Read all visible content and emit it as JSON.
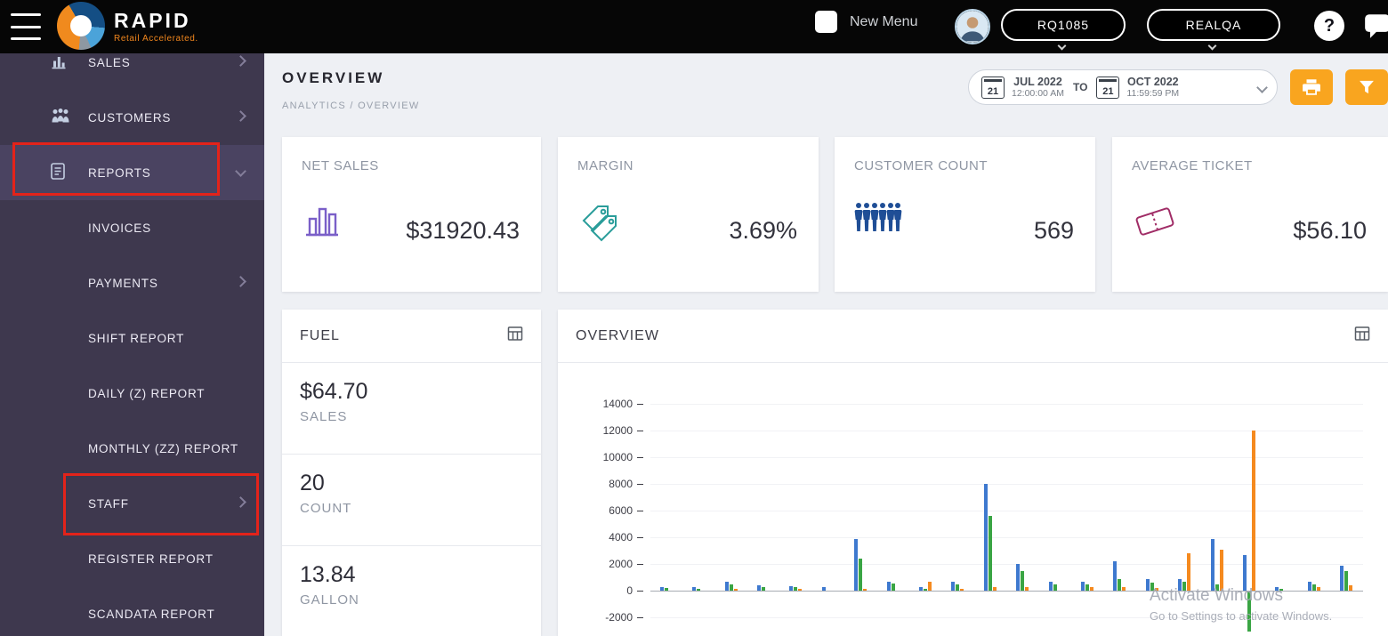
{
  "header": {
    "brand_name": "RAPID",
    "brand_tagline": "Retail Accelerated.",
    "new_menu_label": "New Menu",
    "store_code": "RQ1085",
    "env_code": "REALQA",
    "help_glyph": "?"
  },
  "sidebar": {
    "items": [
      {
        "label": "SALES",
        "icon": "sales-bars-icon"
      },
      {
        "label": "CUSTOMERS",
        "icon": "customers-people-icon"
      },
      {
        "label": "REPORTS",
        "icon": "report-document-icon"
      }
    ],
    "report_items": [
      "INVOICES",
      "PAYMENTS",
      "SHIFT REPORT",
      "DAILY (Z) REPORT",
      "MONTHLY (ZZ) REPORT",
      "STAFF",
      "REGISTER REPORT",
      "SCANDATA REPORT"
    ]
  },
  "page": {
    "title": "OVERVIEW",
    "breadcrumb": "ANALYTICS / OVERVIEW"
  },
  "date_range": {
    "start_day": "21",
    "start_month": "JUL 2022",
    "start_time": "12:00:00 AM",
    "to_label": "TO",
    "end_day": "21",
    "end_month": "OCT 2022",
    "end_time": "11:59:59 PM"
  },
  "toolbar": {
    "print_icon": "printer-icon",
    "filter_icon": "funnel-icon"
  },
  "kpis": [
    {
      "label": "NET SALES",
      "value": "$31920.43",
      "icon": "bar-chart-icon",
      "color": "#7a5fc8"
    },
    {
      "label": "MARGIN",
      "value": "3.69%",
      "icon": "price-tags-icon",
      "color": "#2a9d9a"
    },
    {
      "label": "CUSTOMER COUNT",
      "value": "569",
      "icon": "people-group-icon",
      "color": "#1f4e96"
    },
    {
      "label": "AVERAGE TICKET",
      "value": "$56.10",
      "icon": "ticket-icon",
      "color": "#a02c66"
    }
  ],
  "fuel": {
    "title": "FUEL",
    "table_icon": "table-icon",
    "stats": [
      {
        "value": "$64.70",
        "label": "SALES"
      },
      {
        "value": "20",
        "label": "COUNT"
      },
      {
        "value": "13.84",
        "label": "GALLON"
      }
    ]
  },
  "overview_panel": {
    "title": "OVERVIEW",
    "table_icon": "table-icon"
  },
  "watermark": {
    "line1": "Activate Windows",
    "line2": "Go to Settings to activate Windows."
  },
  "chart_data": {
    "type": "bar",
    "title": "OVERVIEW",
    "ylim": [
      -2000,
      14000
    ],
    "yticks": [
      14000,
      12000,
      10000,
      8000,
      6000,
      4000,
      2000,
      0,
      -2000
    ],
    "grid": false,
    "legend": "none",
    "x_count": 22,
    "series": [
      {
        "name": "blue",
        "color": "#3e79cf",
        "values": [
          300,
          250,
          700,
          400,
          350,
          250,
          3900,
          700,
          300,
          700,
          8000,
          2000,
          650,
          650,
          2200,
          900,
          900,
          3900,
          2700,
          250,
          700,
          1900
        ]
      },
      {
        "name": "green",
        "color": "#3aa544",
        "values": [
          200,
          150,
          450,
          300,
          250,
          0,
          2400,
          550,
          150,
          450,
          5600,
          1450,
          450,
          450,
          900,
          600,
          650,
          500,
          -3000,
          150,
          450,
          1500
        ]
      },
      {
        "name": "orange",
        "color": "#f58a1f",
        "values": [
          0,
          0,
          120,
          0,
          150,
          0,
          150,
          0,
          650,
          150,
          300,
          300,
          0,
          250,
          300,
          200,
          2800,
          3100,
          12000,
          0,
          250,
          400
        ]
      }
    ]
  }
}
